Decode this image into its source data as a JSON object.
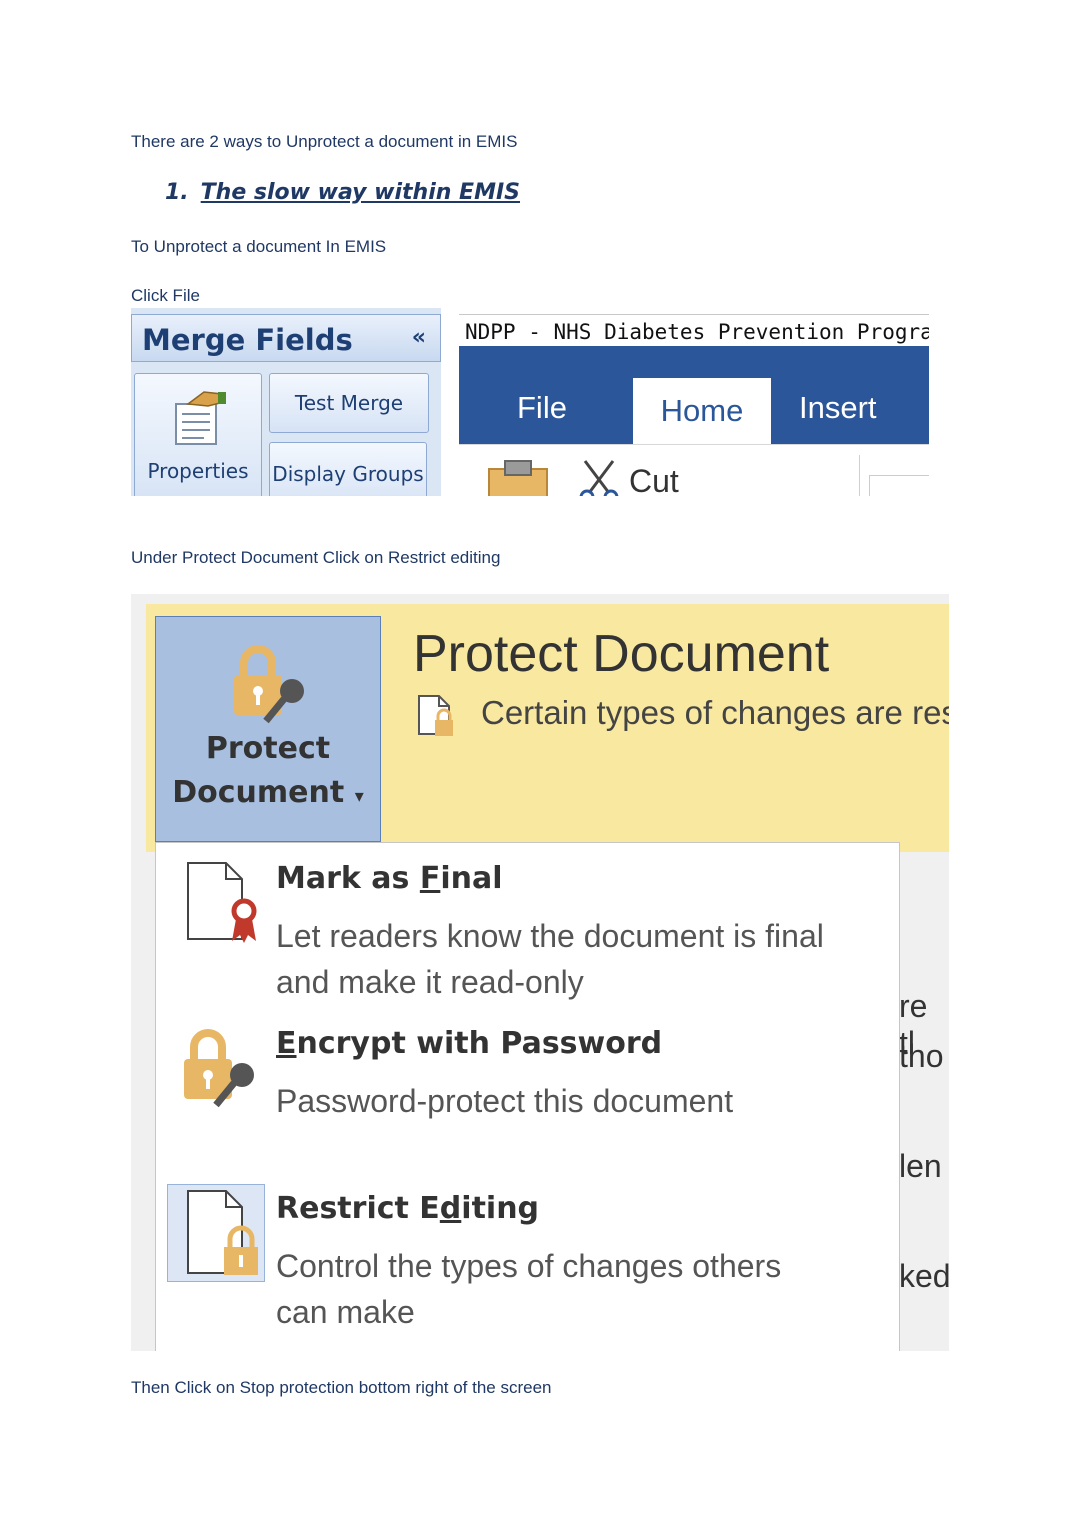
{
  "intro": "There are 2 ways to Unprotect a document in EMIS",
  "heading": {
    "number": "1.",
    "text": "The slow way within EMIS"
  },
  "step1": "To Unprotect a document In EMIS",
  "step2": "Click File",
  "emis": {
    "panel_title": "Merge Fields",
    "collapse": "«",
    "properties": "Properties",
    "test_merge": "Test Merge",
    "display_groups": "Display Groups",
    "window_title": "NDPP - NHS Diabetes Prevention Programme F",
    "tabs": {
      "file": "File",
      "home": "Home",
      "insert": "Insert"
    },
    "cut": "Cut"
  },
  "step3": "Under Protect Document Click on Restrict editing",
  "protect": {
    "button_line1": "Protect",
    "button_line2": "Document",
    "dropdown_arrow": "▾",
    "title": "Protect Document",
    "subtitle": "Certain types of changes are rest",
    "items": [
      {
        "title_pre": "Mark as ",
        "title_ul": "F",
        "title_post": "inal",
        "desc1": "Let readers know the document is final",
        "desc2": "and make it read-only"
      },
      {
        "title_pre": "",
        "title_ul": "E",
        "title_post": "ncrypt with Password",
        "desc1": "Password-protect this document",
        "desc2": ""
      },
      {
        "title_pre": "Restrict E",
        "title_ul": "d",
        "title_post": "iting",
        "desc1": "Control the types of changes others",
        "desc2": "can make"
      }
    ],
    "background_fragments": [
      "re tl",
      "tho",
      "len ",
      "ked"
    ]
  },
  "step4": "Then Click on Stop protection bottom right of the screen",
  "colors": {
    "text": "#1f3864",
    "ribbon": "#2b579a",
    "yellow": "#f9e8a0",
    "lock": "#e8b765"
  }
}
